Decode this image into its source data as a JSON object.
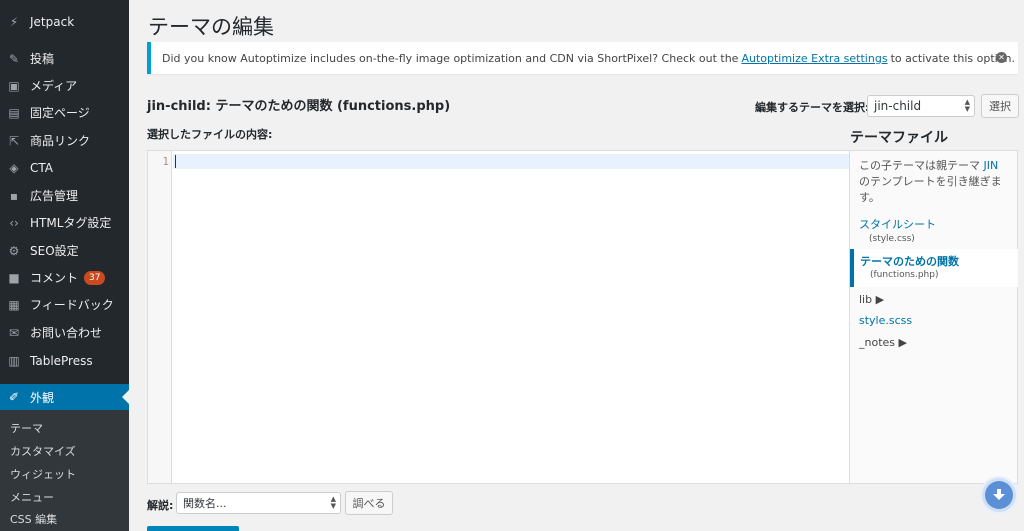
{
  "sidebar": {
    "items": [
      {
        "label": "Jetpack",
        "icon": "jetpack-icon",
        "glyph": "⚡"
      },
      {
        "label": "投稿",
        "icon": "pin-icon",
        "glyph": "✎"
      },
      {
        "label": "メディア",
        "icon": "media-icon",
        "glyph": "▣"
      },
      {
        "label": "固定ページ",
        "icon": "page-icon",
        "glyph": "▤"
      },
      {
        "label": "商品リンク",
        "icon": "share-icon",
        "glyph": "⇱"
      },
      {
        "label": "CTA",
        "icon": "tag-icon",
        "glyph": "◈"
      },
      {
        "label": "広告管理",
        "icon": "id-card-icon",
        "glyph": "▪"
      },
      {
        "label": "HTMLタグ設定",
        "icon": "code-icon",
        "glyph": "‹›"
      },
      {
        "label": "SEO設定",
        "icon": "gear-icon",
        "glyph": "⚙"
      },
      {
        "label": "コメント",
        "icon": "comment-icon",
        "glyph": "■",
        "badge": "37"
      },
      {
        "label": "フィードバック",
        "icon": "feedback-icon",
        "glyph": "▦"
      },
      {
        "label": "お問い合わせ",
        "icon": "mail-icon",
        "glyph": "✉"
      },
      {
        "label": "TablePress",
        "icon": "table-icon",
        "glyph": "▥"
      }
    ],
    "active": {
      "label": "外観",
      "icon": "brush-icon",
      "glyph": "✐"
    },
    "submenu": [
      "テーマ",
      "カスタマイズ",
      "ウィジェット",
      "メニュー",
      "CSS 編集"
    ]
  },
  "header": {
    "title": "テーマの編集"
  },
  "notice": {
    "text_before": "Did you know Autoptimize includes on-the-fly image optimization and CDN via ShortPixel? Check out the",
    "link": "Autoptimize Extra settings",
    "text_after": "to activate this option."
  },
  "editor": {
    "file_heading": "jin-child: テーマのための関数 (functions.php)",
    "theme_select_label": "編集するテーマを選択:",
    "theme_select_value": "jin-child",
    "select_button": "選択",
    "content_label": "選択したファイルの内容:",
    "line_number": "1"
  },
  "files": {
    "title": "テーマファイル",
    "desc_before": "この子テーマは親テーマ",
    "desc_link": "JIN",
    "desc_after": "のテンプレートを引き継ぎます。",
    "items": [
      {
        "name": "スタイルシート",
        "file": "(style.css)"
      },
      {
        "name": "テーマのための関数",
        "file": "(functions.php)",
        "active": true
      }
    ],
    "lib": "lib ▶",
    "scss": "style.scss",
    "notes": "_notes ▶"
  },
  "footer": {
    "doc_label": "解説:",
    "doc_select_value": "関数名...",
    "lookup_button": "調べる"
  },
  "colors": {
    "sidebar_bg": "#23282d",
    "accent": "#0073aa",
    "notice_border": "#00a0d2",
    "badge": "#ca4a1f"
  }
}
